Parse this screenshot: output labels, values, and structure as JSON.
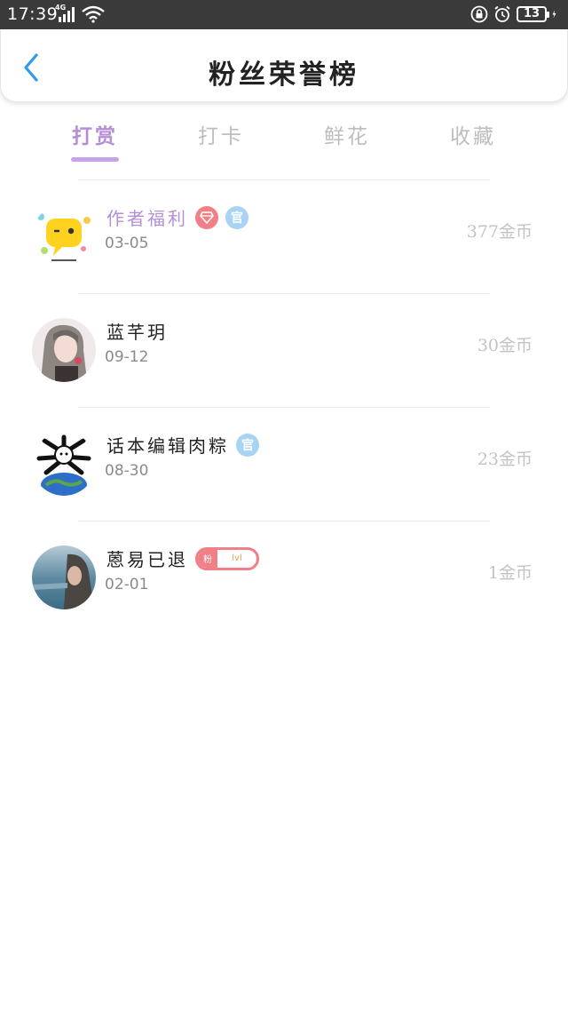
{
  "status_bar": {
    "time": "17:39",
    "network": "4G",
    "battery": "13"
  },
  "header": {
    "title": "粉丝荣誉榜",
    "back_icon": "chevron-left-icon"
  },
  "tabs": [
    {
      "label": "打赏",
      "active": true
    },
    {
      "label": "打卡",
      "active": false
    },
    {
      "label": "鲜花",
      "active": false
    },
    {
      "label": "收藏",
      "active": false
    }
  ],
  "rows": [
    {
      "name": "作者福利",
      "date": "03-05",
      "amount": "377金币",
      "badges": [
        "diamond",
        "官"
      ],
      "highlight": true
    },
    {
      "name": "蓝芊玥",
      "date": "09-12",
      "amount": "30金币",
      "badges": [],
      "highlight": false
    },
    {
      "name": "话本编辑肉粽",
      "date": "08-30",
      "amount": "23金币",
      "badges": [
        "官"
      ],
      "highlight": false
    },
    {
      "name": "蒽易已退",
      "date": "02-01",
      "amount": "1金币",
      "badges": [
        "fan"
      ],
      "highlight": false
    }
  ],
  "badges": {
    "guan": "官",
    "fan_label": "粉",
    "fan_level": "lvl"
  },
  "colors": {
    "accent_purple": "#b48fd6",
    "tab_underline": "#c6a4ea",
    "badge_red": "#f07f86",
    "badge_blue": "#a9d3f2",
    "back_blue": "#2f9ae8"
  }
}
